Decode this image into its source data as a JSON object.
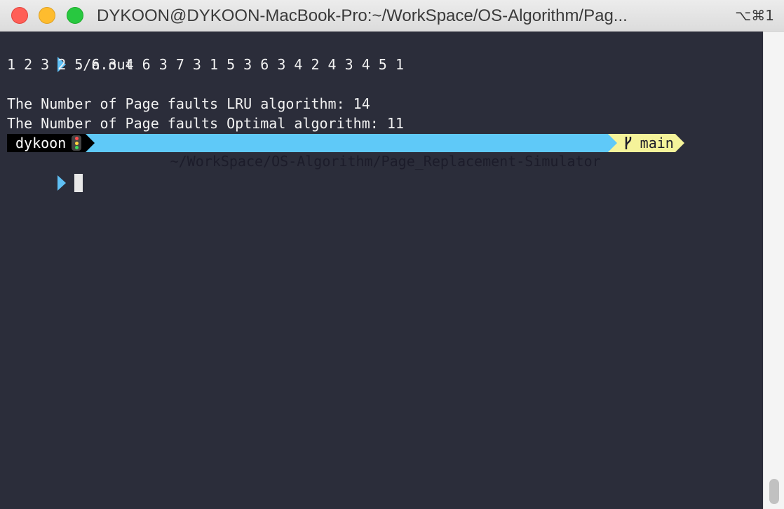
{
  "window": {
    "title": "DYKOON@DYKOON-MacBook-Pro:~/WorkSpace/OS-Algorithm/Pag...",
    "shortcut": "⌥⌘1"
  },
  "terminal": {
    "command": "./a.out",
    "output_lines": [
      "1 2 3 2 5 6 3 4 6 3 7 3 1 5 3 6 3 4 2 4 3 4 5 1",
      "",
      "The Number of Page faults LRU algorithm: 14",
      "The Number of Page faults Optimal algorithm: 11"
    ],
    "prompt": {
      "user": "dykoon",
      "path": "~/WorkSpace/OS-Algorithm/Page_Replacement-Simulator",
      "branch": "main"
    }
  },
  "colors": {
    "background": "#2b2d3a",
    "prompt_arrow": "#5fc0f5",
    "path_segment": "#5fc9f8",
    "git_segment": "#f5f39a"
  }
}
